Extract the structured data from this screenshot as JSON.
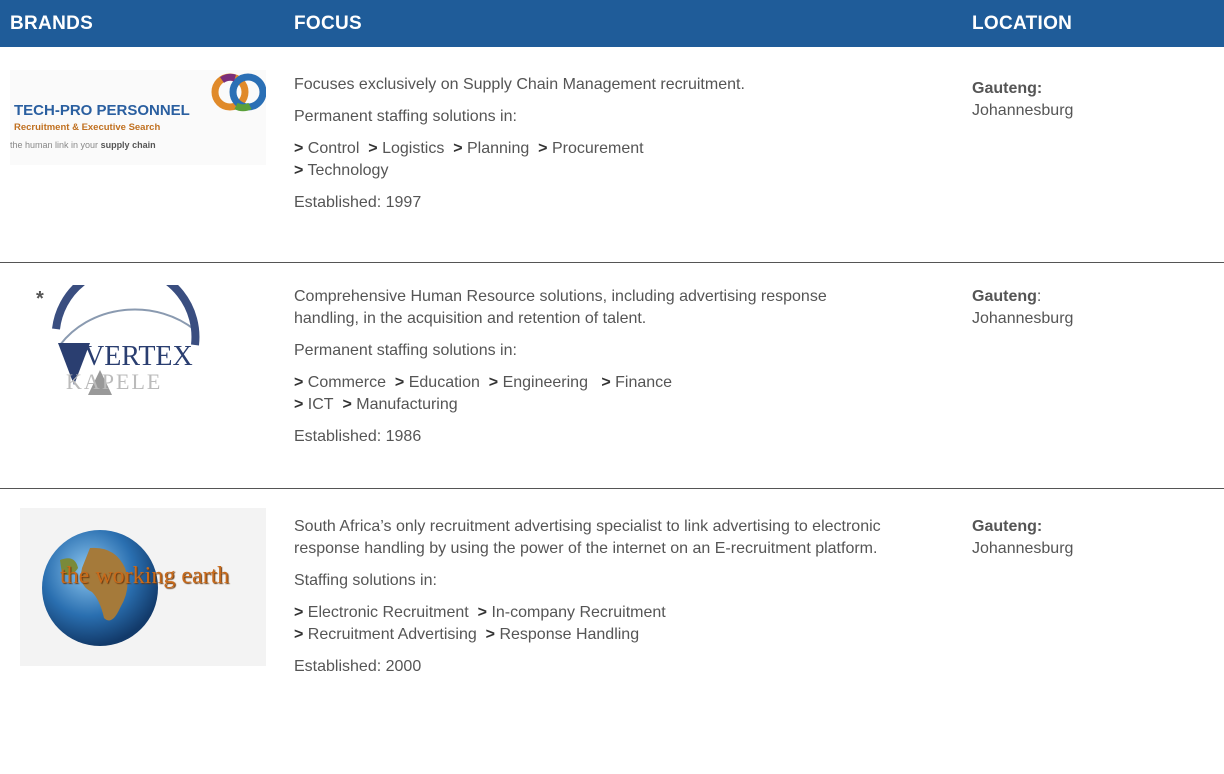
{
  "header": {
    "brands": "BRANDS",
    "focus": "FOCUS",
    "location": "LOCATION",
    "bg_color": "#1f5c99"
  },
  "rows": [
    {
      "logo": {
        "line1": "TECH-PRO PERSONNEL",
        "line2": "Recruitment & Executive Search",
        "line3a": "the human link in your ",
        "line3b": "supply chain",
        "icon": "interlocking-rings-logo"
      },
      "description": "Focuses exclusively on Supply Chain Management recruitment.",
      "solutions_intro": "Permanent staffing solutions in:",
      "solutions_line1": [
        "Control",
        "Logistics",
        "Planning",
        "Procurement"
      ],
      "solutions_line2": [
        "Technology"
      ],
      "established_label": "Established:",
      "established_year": "1997",
      "location_label": "Gauteng:",
      "location_city": "Johannesburg"
    },
    {
      "logo": {
        "marker": "*",
        "line1": "VERTEX",
        "line2": "KAPELE",
        "icon": "arc-triangle-logo"
      },
      "description": "Comprehensive Human Resource solutions, including advertising response handling, in the acquisition and retention of talent.",
      "solutions_intro": "Permanent staffing solutions in:",
      "solutions_line1": [
        "Commerce",
        "Education",
        "Engineering",
        "Finance"
      ],
      "solutions_line2": [
        "ICT",
        "Manufacturing"
      ],
      "established_label": "Established:",
      "established_year": "1986",
      "location_label": "Gauteng",
      "location_colon": ":",
      "location_city": "Johannesburg"
    },
    {
      "logo": {
        "marker": "*",
        "line1": "the working earth",
        "icon": "globe-logo"
      },
      "description": "South Africa’s only recruitment advertising specialist to link advertising to electronic response handling by using the power of the internet on an E-recruitment platform.",
      "solutions_intro": "Staffing solutions in:",
      "solutions_line1": [
        "Electronic Recruitment",
        "In-company Recruitment"
      ],
      "solutions_line2": [
        "Recruitment Advertising",
        "Response Handling"
      ],
      "established_label": "Established:",
      "established_year": "2000",
      "location_label": "Gauteng:",
      "location_city": "Johannesburg"
    }
  ],
  "bullet": ">"
}
